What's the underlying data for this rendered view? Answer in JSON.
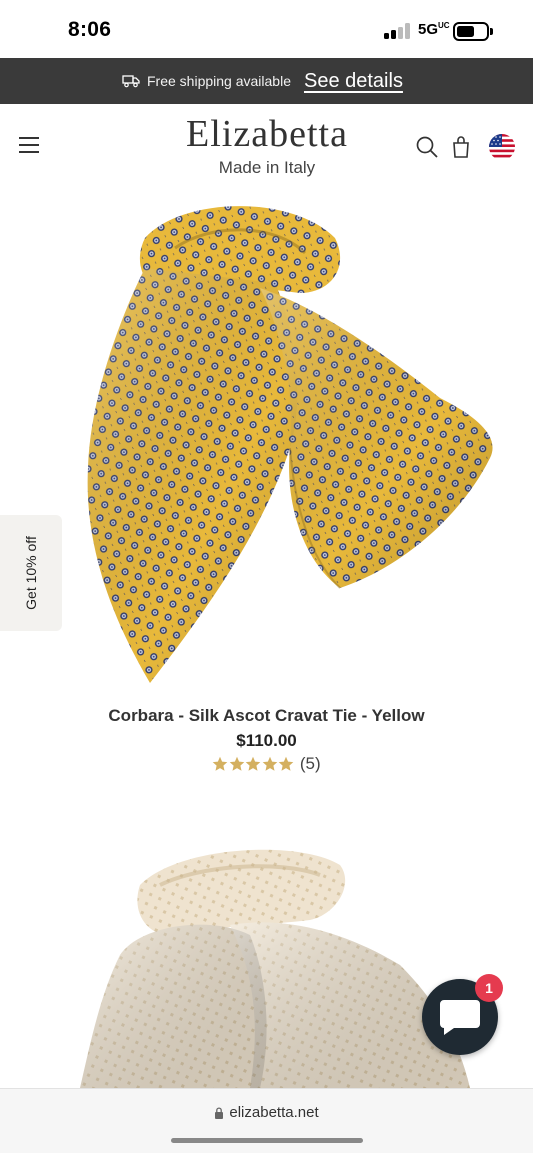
{
  "status_bar": {
    "time": "8:06",
    "network": "5G",
    "network_superscript": "UC"
  },
  "promo": {
    "shipping_text": "Free shipping available",
    "details_link": "See details",
    "icon": "truck-icon"
  },
  "header": {
    "brand": "Elizabetta",
    "tagline": "Made in Italy",
    "icons": [
      "menu-icon",
      "search-icon",
      "cart-icon",
      "us-flag-icon"
    ]
  },
  "discount_tab": {
    "label": "Get 10% off"
  },
  "products": [
    {
      "title": "Corbara - Silk Ascot Cravat Tie - Yellow",
      "price": "$110.00",
      "rating": 5,
      "review_count": "(5)",
      "image_color": "#e8b93b"
    },
    {
      "image_color": "#efe3cf"
    }
  ],
  "chat": {
    "badge_count": "1",
    "icon": "chat-bubble-icon"
  },
  "browser": {
    "url": "elizabetta.net",
    "icon": "lock-icon"
  },
  "colors": {
    "banner_bg": "#3a3a3a",
    "star": "#d4b060",
    "chat_bg": "#1f2a33",
    "badge": "#e53b4f"
  }
}
